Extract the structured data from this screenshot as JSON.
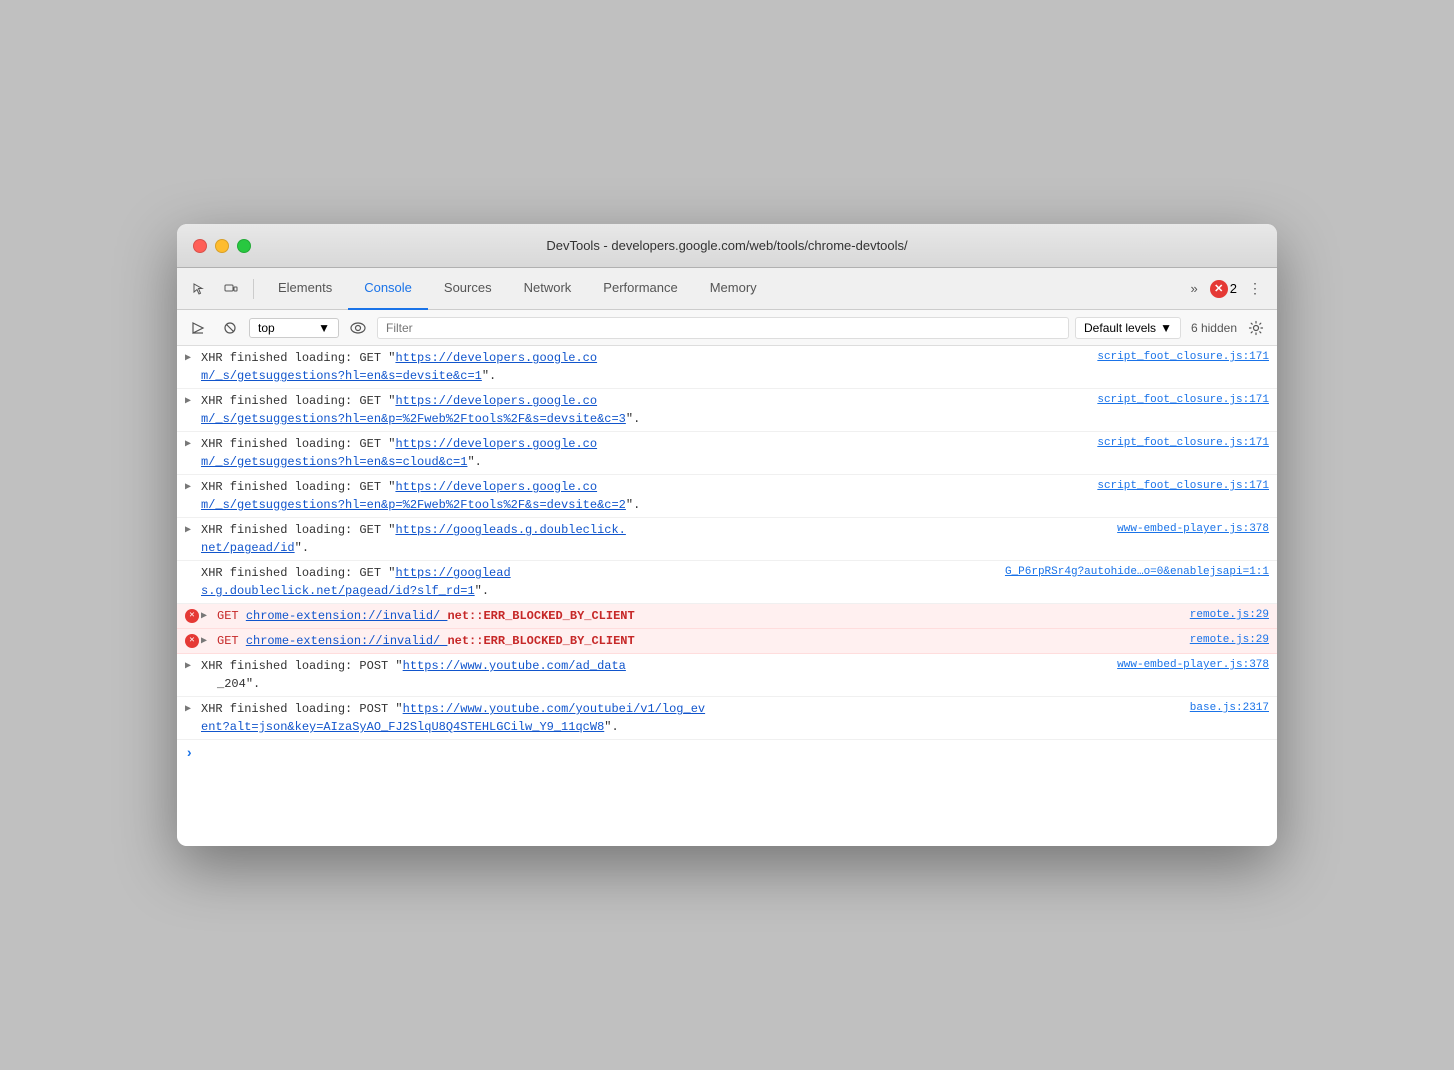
{
  "window": {
    "title": "DevTools - developers.google.com/web/tools/chrome-devtools/"
  },
  "toolbar": {
    "tabs": [
      {
        "id": "elements",
        "label": "Elements",
        "active": false
      },
      {
        "id": "console",
        "label": "Console",
        "active": true
      },
      {
        "id": "sources",
        "label": "Sources",
        "active": false
      },
      {
        "id": "network",
        "label": "Network",
        "active": false
      },
      {
        "id": "performance",
        "label": "Performance",
        "active": false
      },
      {
        "id": "memory",
        "label": "Memory",
        "active": false
      }
    ],
    "overflow_label": "»",
    "error_count": "2",
    "more_label": "⋮"
  },
  "console_toolbar": {
    "context": "top",
    "filter_placeholder": "Filter",
    "level_label": "Default levels",
    "hidden_count": "6 hidden"
  },
  "log_entries": [
    {
      "id": 1,
      "type": "info",
      "triangle": "▶",
      "message_prefix": "XHR finished loading: GET \"",
      "link_text": "https://developers.google.co\nm/_s/getsuggestions?hl=en&s=devsite&c=1",
      "message_suffix": "\".",
      "source": "script_foot_closure.js:171",
      "error": false
    },
    {
      "id": 2,
      "type": "info",
      "triangle": "▶",
      "message_prefix": "XHR finished loading: GET \"",
      "link_text": "https://developers.google.co\nm/_s/getsuggestions?hl=en&p=%2Fweb%2Ftools%2F&s=devsite&c=3",
      "message_suffix": "\".",
      "source": "script_foot_closure.js:171",
      "error": false
    },
    {
      "id": 3,
      "type": "info",
      "triangle": "▶",
      "message_prefix": "XHR finished loading: GET \"",
      "link_text": "https://developers.google.co\nm/_s/getsuggestions?hl=en&s=cloud&c=1",
      "message_suffix": "\".",
      "source": "script_foot_closure.js:171",
      "error": false
    },
    {
      "id": 4,
      "type": "info",
      "triangle": "▶",
      "message_prefix": "XHR finished loading: GET \"",
      "link_text": "https://developers.google.co\nm/_s/getsuggestions?hl=en&p=%2Fweb%2Ftools%2F&s=devsite&c=2",
      "message_suffix": "\".",
      "source": "script_foot_closure.js:171",
      "error": false
    },
    {
      "id": 5,
      "type": "info",
      "triangle": "▶",
      "message_prefix": "XHR finished loading: GET \"",
      "link_text": "https://googleads.g.doubleclick.\nnet/pagead/id",
      "message_suffix": "\".",
      "source": "www-embed-player.js:378",
      "error": false
    },
    {
      "id": 6,
      "type": "info",
      "triangle": "",
      "message_prefix": "XHR finished loading: GET \"",
      "link_text": "https://googlead\ns.g.doubleclick.net/pagead/id?slf_rd=1",
      "message_suffix": "\".",
      "source": "G_P6rpRSr4g?autohide…o=0&enablejsapi=1:1",
      "error": false
    },
    {
      "id": 7,
      "type": "error",
      "triangle": "▶",
      "get_label": "GET",
      "get_link": "chrome-extension://invalid/",
      "err_msg": "net::ERR_BLOCKED_BY_CLIENT",
      "source": "remote.js:29",
      "error": true
    },
    {
      "id": 8,
      "type": "error",
      "triangle": "▶",
      "get_label": "GET",
      "get_link": "chrome-extension://invalid/",
      "err_msg": "net::ERR_BLOCKED_BY_CLIENT",
      "source": "remote.js:29",
      "error": true
    },
    {
      "id": 9,
      "type": "info",
      "triangle": "▶",
      "message_prefix": "XHR finished loading: POST \"",
      "link_text": "https://www.youtube.com/ad_data",
      "message_suffix": "",
      "source": "www-embed-player.js:378\n_204\".",
      "error": false
    },
    {
      "id": 10,
      "type": "info",
      "triangle": "▶",
      "message_prefix": "XHR finished loading: POST \"",
      "link_text": "https://www.youtube.com/youtubei/v1/log_ev\nent?alt=json&key=AIzaSyAO_FJ2SlqU8Q4STEHLGCilw_Y9_11qcW8",
      "message_suffix": "\".",
      "source": "base.js:2317",
      "error": false
    }
  ]
}
